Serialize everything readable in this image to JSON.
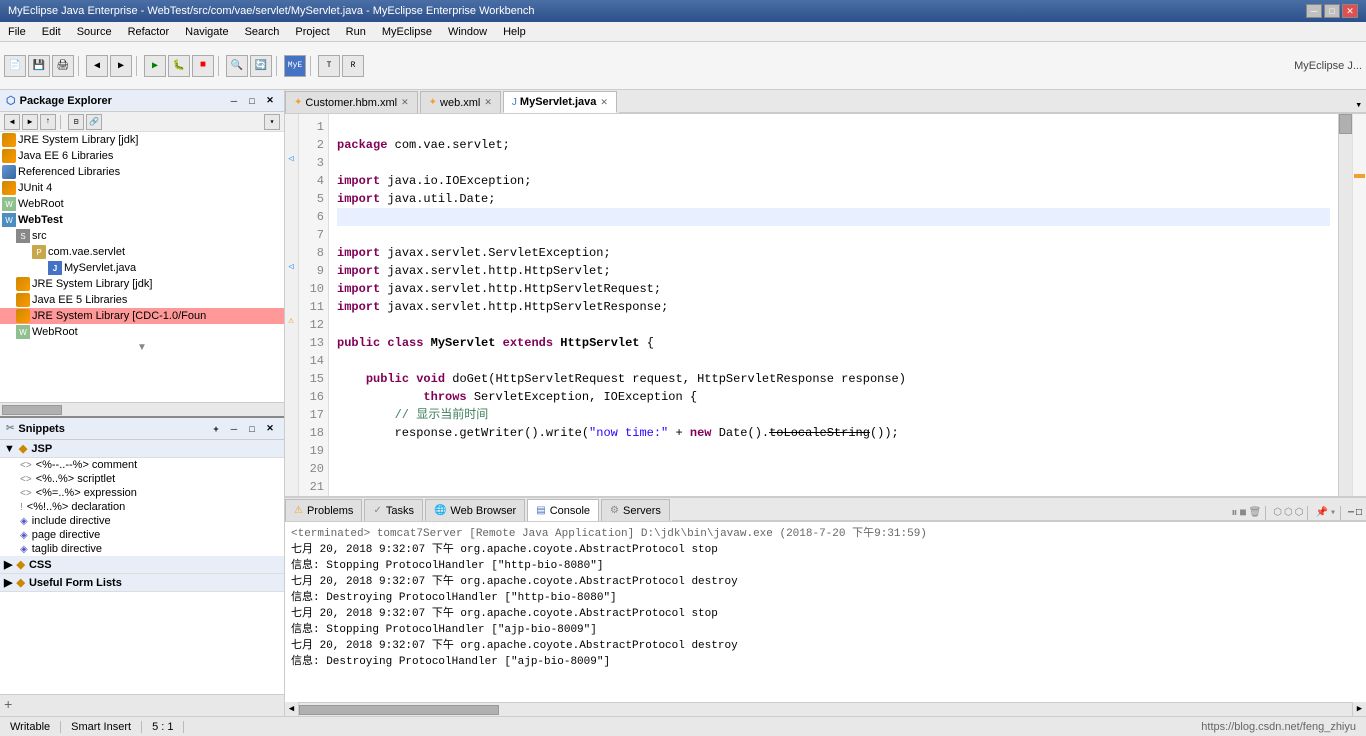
{
  "titlebar": {
    "title": "MyEclipse Java Enterprise - WebTest/src/com/vae/servlet/MyServlet.java - MyEclipse Enterprise Workbench",
    "minimize": "─",
    "maximize": "□",
    "close": "✕"
  },
  "menubar": {
    "items": [
      "File",
      "Edit",
      "Source",
      "Refactor",
      "Navigate",
      "Search",
      "Project",
      "Run",
      "MyEclipse",
      "Window",
      "Help"
    ]
  },
  "package_explorer": {
    "title": "Package Explorer",
    "items": [
      {
        "id": "jre-system-lib-jdk",
        "label": "JRE System Library [jdk]",
        "indent": 0,
        "type": "jre"
      },
      {
        "id": "java-ee-6-libs",
        "label": "Java EE 6 Libraries",
        "indent": 0,
        "type": "javaee"
      },
      {
        "id": "referenced-libs",
        "label": "Referenced Libraries",
        "indent": 0,
        "type": "ref"
      },
      {
        "id": "junit4",
        "label": "JUnit 4",
        "indent": 0,
        "type": "junit"
      },
      {
        "id": "webroot-top",
        "label": "WebRoot",
        "indent": 0,
        "type": "webroot"
      },
      {
        "id": "webtest",
        "label": "WebTest",
        "indent": 0,
        "type": "project"
      },
      {
        "id": "src",
        "label": "src",
        "indent": 1,
        "type": "src"
      },
      {
        "id": "com.vae.servlet",
        "label": "com.vae.servlet",
        "indent": 2,
        "type": "package"
      },
      {
        "id": "myservlet-java",
        "label": "MyServlet.java",
        "indent": 3,
        "type": "java"
      },
      {
        "id": "jre-system-lib-jdk2",
        "label": "JRE System Library [jdk]",
        "indent": 1,
        "type": "jre"
      },
      {
        "id": "java-ee-5-libs",
        "label": "Java EE 5 Libraries",
        "indent": 1,
        "type": "javaee"
      },
      {
        "id": "jre-system-cdc",
        "label": "JRE System Library [CDC-1.0/Foun",
        "indent": 1,
        "type": "jre",
        "highlighted": true
      },
      {
        "id": "webroot-bottom",
        "label": "WebRoot",
        "indent": 1,
        "type": "webroot"
      }
    ]
  },
  "snippets": {
    "title": "Snippets",
    "categories": [
      {
        "id": "jsp",
        "label": "JSP",
        "items": [
          {
            "id": "comment",
            "label": "<%--..--%> comment"
          },
          {
            "id": "scriptlet",
            "label": "<%..%> scriptlet"
          },
          {
            "id": "expression",
            "label": "<%=..%> expression"
          },
          {
            "id": "declaration",
            "label": "<%!..%> declaration"
          },
          {
            "id": "include",
            "label": "include directive"
          },
          {
            "id": "page",
            "label": "page directive"
          },
          {
            "id": "taglib",
            "label": "taglib directive"
          }
        ]
      },
      {
        "id": "css",
        "label": "CSS",
        "items": []
      },
      {
        "id": "useful-forms",
        "label": "Useful Form Lists",
        "items": []
      }
    ]
  },
  "editor": {
    "tabs": [
      {
        "id": "customer-hbm",
        "label": "Customer.hbm.xml",
        "active": false,
        "icon": "xml"
      },
      {
        "id": "web-xml",
        "label": "web.xml",
        "active": false,
        "icon": "xml"
      },
      {
        "id": "myservlet-java",
        "label": "MyServlet.java",
        "active": true,
        "icon": "java"
      }
    ],
    "code": {
      "package_line": "package com.vae.servlet;",
      "import1": "import java.io.IOException;",
      "import2": "import java.util.Date;",
      "import3": "import javax.servlet.ServletException;",
      "import4": "import javax.servlet.http.HttpServlet;",
      "import5": "import javax.servlet.http.HttpServletRequest;",
      "import6": "import javax.servlet.http.HttpServletResponse;",
      "class_decl": "public class MyServlet extends HttpServlet {",
      "method_decl": "    public void doGet(HttpServletRequest request, HttpServletResponse response)",
      "throws_decl": "            throws ServletException, IOException {",
      "comment": "        // 显示当前时间",
      "response_write": "        response.getWriter().write(\"now time:\" + new Date().toLocaleString());"
    }
  },
  "bottom_panel": {
    "tabs": [
      {
        "id": "problems",
        "label": "Problems",
        "icon": "warn",
        "active": false
      },
      {
        "id": "tasks",
        "label": "Tasks",
        "icon": "task",
        "active": false
      },
      {
        "id": "web-browser",
        "label": "Web Browser",
        "icon": "browser",
        "active": false
      },
      {
        "id": "console",
        "label": "Console",
        "icon": "console",
        "active": true
      },
      {
        "id": "servers",
        "label": "Servers",
        "icon": "server",
        "active": false
      }
    ],
    "console": {
      "terminated_line": "<terminated> tomcat7Server [Remote Java Application] D:\\jdk\\bin\\javaw.exe (2018-7-20 下午9:31:59)",
      "lines": [
        "七月 20, 2018 9:32:07 下午 org.apache.coyote.AbstractProtocol stop",
        "信息: Stopping ProtocolHandler [\"http-bio-8080\"]",
        "七月 20, 2018 9:32:07 下午 org.apache.coyote.AbstractProtocol destroy",
        "信息: Destroying ProtocolHandler [\"http-bio-8080\"]",
        "七月 20, 2018 9:32:07 下午 org.apache.coyote.AbstractProtocol stop",
        "信息: Stopping ProtocolHandler [\"ajp-bio-8009\"]",
        "七月 20, 2018 9:32:07 下午 org.apache.coyote.AbstractProtocol destroy",
        "信息: Destroying ProtocolHandler [\"ajp-bio-8009\"]"
      ]
    }
  },
  "statusbar": {
    "writable": "Writable",
    "smart_insert": "Smart Insert",
    "position": "5 : 1",
    "url": "https://blog.csdn.net/feng_zhiyu"
  }
}
